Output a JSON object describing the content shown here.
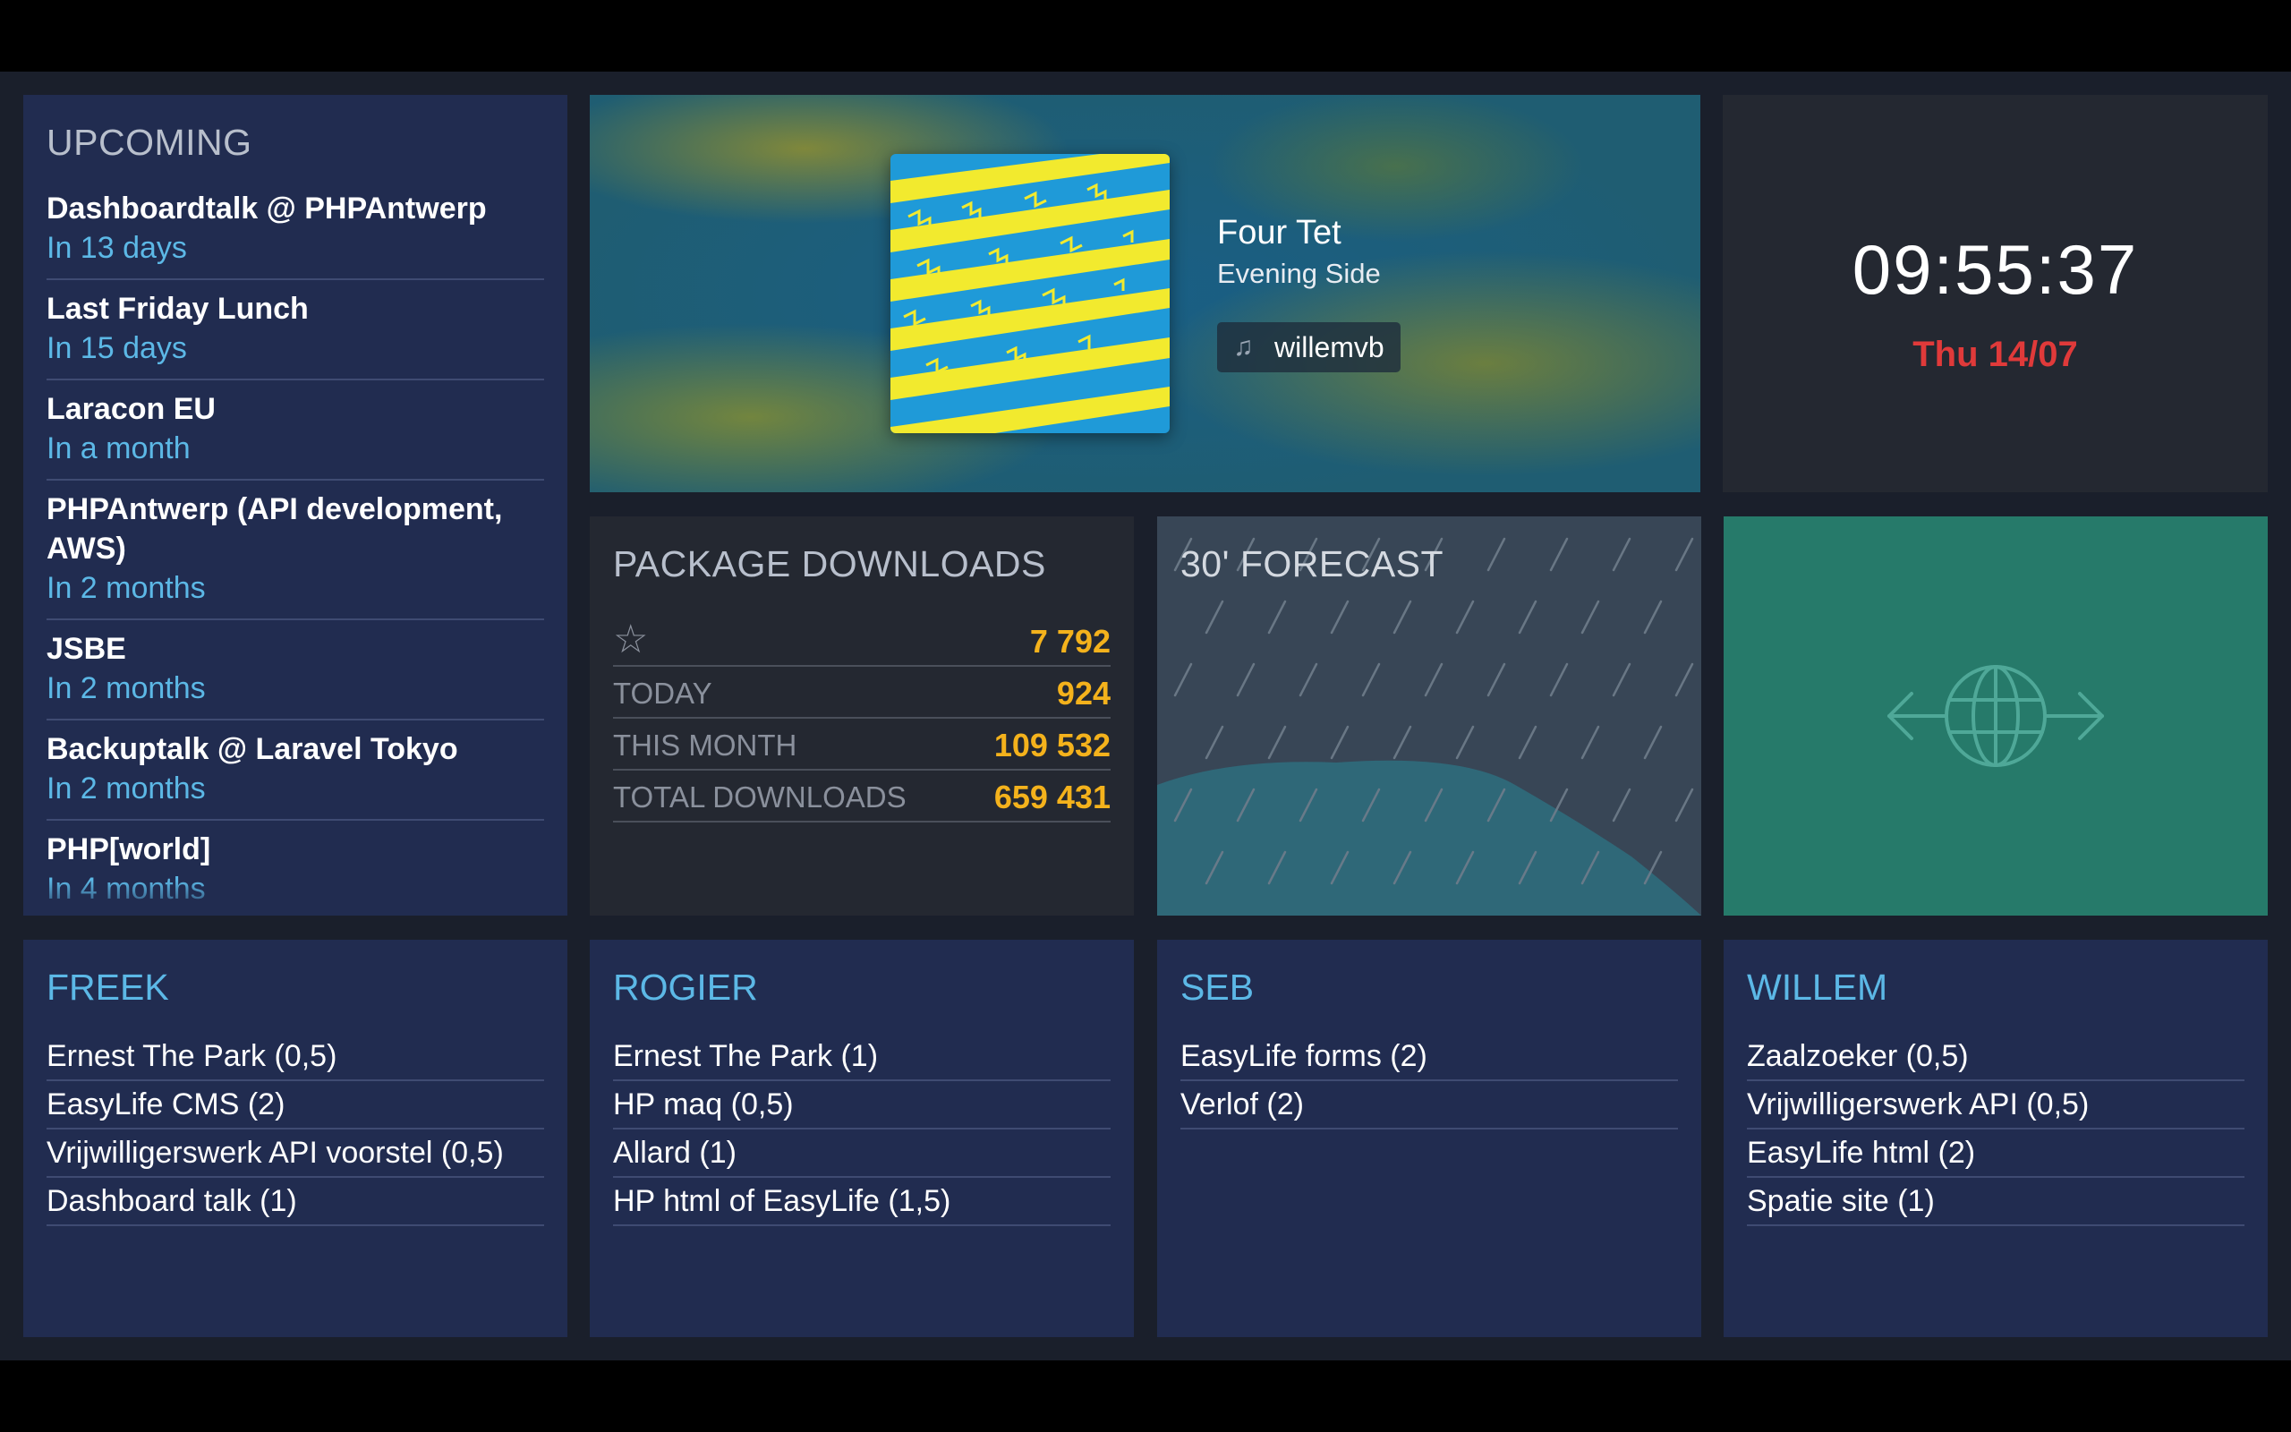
{
  "upcoming": {
    "title": "UPCOMING",
    "events": [
      {
        "title": "Dashboardtalk @ PHPAntwerp",
        "when": "In 13 days"
      },
      {
        "title": "Last Friday Lunch",
        "when": "In 15 days"
      },
      {
        "title": "Laracon EU",
        "when": "In a month"
      },
      {
        "title": "PHPAntwerp (API development, AWS)",
        "when": "In 2 months"
      },
      {
        "title": "JSBE",
        "when": "In 2 months"
      },
      {
        "title": "Backuptalk @ Laravel Tokyo",
        "when": "In 2 months"
      },
      {
        "title": "PHP[world]",
        "when": "In 4 months"
      }
    ]
  },
  "music": {
    "artist": "Four Tet",
    "track": "Evening Side",
    "user": "willemvb",
    "user_icon": "music-note-icon",
    "colors": {
      "album_blue": "#1f9ad8",
      "album_yellow": "#f2ea2e"
    }
  },
  "clock": {
    "time": "09:55:37",
    "date": "Thu 14/07",
    "date_color": "#e03a3a"
  },
  "packages": {
    "title": "PACKAGE DOWNLOADS",
    "stars_icon": "star-icon",
    "stars": "7 792",
    "rows": [
      {
        "label": "TODAY",
        "value": "924"
      },
      {
        "label": "THIS MONTH",
        "value": "109 532"
      },
      {
        "label": "TOTAL DOWNLOADS",
        "value": "659 431"
      }
    ],
    "value_color": "#f4b21c"
  },
  "forecast": {
    "title": "30' FORECAST",
    "icon": "rain-icon"
  },
  "status_tile": {
    "icon": "globe-arrows-icon",
    "color": "#267a6a"
  },
  "team": [
    {
      "name": "FREEK",
      "tasks": [
        "Ernest The Park (0,5)",
        "EasyLife CMS (2)",
        "Vrijwilligerswerk API voorstel (0,5)",
        "Dashboard talk (1)"
      ]
    },
    {
      "name": "ROGIER",
      "tasks": [
        "Ernest The Park (1)",
        "HP maq (0,5)",
        "Allard (1)",
        "HP html of EasyLife (1,5)"
      ]
    },
    {
      "name": "SEB",
      "tasks": [
        "EasyLife forms (2)",
        "Verlof (2)"
      ]
    },
    {
      "name": "WILLEM",
      "tasks": [
        "Zaalzoeker (0,5)",
        "Vrijwilligerswerk API (0,5)",
        "EasyLife html (2)",
        "Spatie site (1)"
      ]
    }
  ]
}
